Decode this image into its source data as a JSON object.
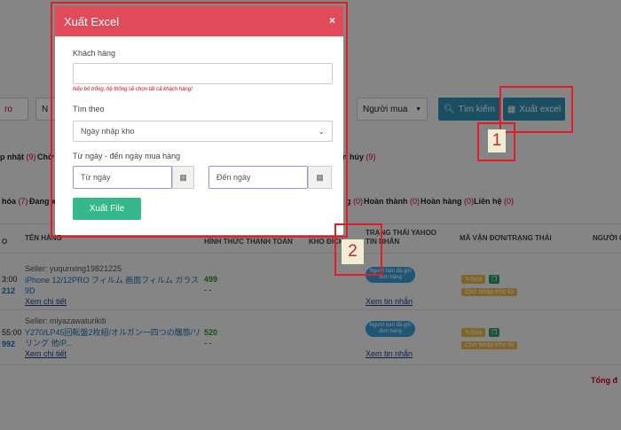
{
  "background": {
    "filter_select_left": "ro",
    "filter_select2": "N",
    "buyer_select": "Người mua",
    "search_button": "Tìm kiếm",
    "export_button": "Xuất excel",
    "status_tabs_row1": [
      {
        "label": "p nhật",
        "count": "(9)"
      },
      {
        "label": "Chờ t",
        "count": ""
      },
      {
        "label": "n hủy",
        "count": "(9)"
      }
    ],
    "status_tabs_row2": [
      {
        "label": "hóa",
        "count": "(7)"
      },
      {
        "label": "Đang x",
        "count": ""
      },
      {
        "label": "g",
        "count": "(0)"
      },
      {
        "label": "Hoàn thành",
        "count": "(0)"
      },
      {
        "label": "Hoàn hàng",
        "count": "(0)"
      },
      {
        "label": "Liên hệ",
        "count": "(0)"
      }
    ],
    "columns": [
      "O",
      "TÊN HÀNG",
      "HÌNH THỨC THANH TOÁN",
      "KHO ĐÍCH",
      "TRẠNG THÁI YAHOO TIN NHẮN",
      "MÃ VẬN ĐƠN/TRẠNG THÁI",
      "NGƯỜI C"
    ],
    "rows": [
      {
        "time": "3:00",
        "id": "212",
        "seller": "Seller: yuqunxing19821225",
        "product": "iPhone 12/12PRO フィルム 画面フィルム ガラス 9D",
        "details_link": "Xem chi tiết",
        "price": "499",
        "dash": "- -",
        "status_pill": "Người bán đã gửi đơn hàng",
        "message_link": "Xem tin nhắn",
        "edit_tag": "Sửa",
        "warehouse_tag": "Chờ Nhập Kho Đi"
      },
      {
        "time": "55:00",
        "id": "992",
        "seller": "Seller: miyazawaturikiti",
        "product": "Y270/LP45回転盤2枚組/オルガン一四つの醜態/リリング 他/P...",
        "details_link": "Xem chi tiết",
        "price": "520",
        "dash": "- -",
        "status_pill": "Người bán đã gửi đơn hàng",
        "message_link": "Xem tin nhắn",
        "edit_tag": "Sửa",
        "warehouse_tag": "Chờ Nhập Kho Đi"
      }
    ],
    "total_label": "Tổng đ"
  },
  "modal": {
    "title": "Xuất Excel",
    "close": "×",
    "customer_label": "Khách hàng",
    "customer_value": "",
    "customer_hint": "Nếu bỏ trống, hệ thống sẽ chọn tất cả khách hàng!",
    "search_by_label": "Tìm theo",
    "search_by_value": "Ngày nhập kho",
    "date_range_label": "Từ ngày - đến ngày mua hàng",
    "from_placeholder": "Từ ngày",
    "to_placeholder": "Đến ngày",
    "submit": "Xuất File"
  },
  "annotations": {
    "marker_1": "1",
    "marker_2": "2",
    "color": "#e51c23"
  },
  "colors": {
    "modal_header": "#e14a58",
    "submit_button": "#35b88a",
    "primary_button": "#2e8fb5"
  }
}
